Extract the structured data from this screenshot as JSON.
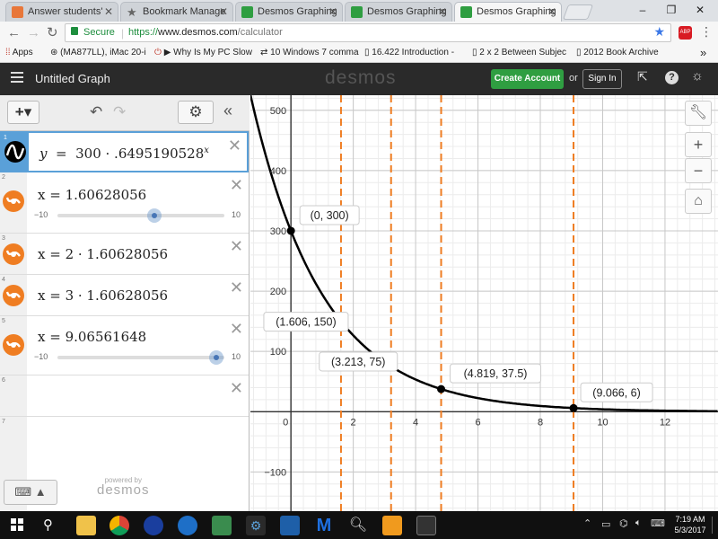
{
  "browser": {
    "tabs": [
      {
        "title": "Answer students'",
        "icon": "page-icon",
        "active": false
      },
      {
        "title": "Bookmark Manage",
        "icon": "star-icon",
        "active": false
      },
      {
        "title": "Desmos Graphing",
        "icon": "desmos-icon",
        "active": false
      },
      {
        "title": "Desmos Graphing",
        "icon": "desmos-icon",
        "active": false
      },
      {
        "title": "Desmos Graphing",
        "icon": "desmos-icon",
        "active": true
      }
    ],
    "window_controls": {
      "minimize": "–",
      "maximize": "❐",
      "close": "✕"
    },
    "secure_label": "Secure",
    "url_prefix": "https://",
    "url_host": "www.desmos.com",
    "url_path": "/calculator",
    "abp_label": "ABP",
    "bookmarks": [
      {
        "label": "Apps",
        "icon": "apps-grid-icon"
      },
      {
        "label": "(MA877LL), iMac 20-i",
        "icon": "wheel-icon"
      },
      {
        "label": "▶ Why Is My PC Slow",
        "icon": "power-icon"
      },
      {
        "label": "10 Windows 7 comma",
        "icon": "arrows-icon"
      },
      {
        "label": "16.422 Introduction -",
        "icon": "doc-icon"
      },
      {
        "label": "2 x 2 Between Subjec",
        "icon": "doc-icon"
      },
      {
        "label": "2012 Book Archive",
        "icon": "doc-icon"
      }
    ],
    "more_bookmarks": "»"
  },
  "desmos": {
    "graph_title": "Untitled Graph",
    "logo": "desmos",
    "create_account": "Create Account",
    "or_label": "or",
    "sign_in": "Sign In",
    "brand_green": "#2f9e41",
    "expressions": [
      {
        "n": "1",
        "type": "function",
        "lhs": "y",
        "mid": "300 · .6495190528",
        "exp": "x",
        "color": "#000000"
      },
      {
        "n": "2",
        "type": "slider",
        "text": "x = 1.60628056",
        "min": "−10",
        "max": "10",
        "value": 1.60628056,
        "color": "#ef7d22"
      },
      {
        "n": "3",
        "type": "vline",
        "text": "x = 2 · 1.60628056",
        "color": "#ef7d22"
      },
      {
        "n": "4",
        "type": "vline",
        "text": "x = 3 · 1.60628056",
        "color": "#ef7d22"
      },
      {
        "n": "5",
        "type": "slider",
        "text": "x = 9.06561648",
        "min": "−10",
        "max": "10",
        "value": 9.06561648,
        "color": "#ef7d22"
      },
      {
        "n": "6",
        "type": "empty"
      },
      {
        "n": "7",
        "type": "empty"
      }
    ],
    "powered_by": "powered by",
    "powered_logo": "desmos"
  },
  "chart_data": {
    "type": "line",
    "series": [
      {
        "expression": "y = 300 · 0.6495190528^x",
        "color": "#000000"
      }
    ],
    "vertical_lines": [
      1.60628056,
      3.21256112,
      4.81884168,
      9.06561648
    ],
    "vertical_line_color": "#ef7d22",
    "points": [
      {
        "x": 0,
        "y": 300,
        "label": "(0, 300)"
      },
      {
        "x": 1.606,
        "y": 150,
        "label": "(1.606, 150)"
      },
      {
        "x": 3.213,
        "y": 75,
        "label": "(3.213, 75)"
      },
      {
        "x": 4.819,
        "y": 37.5,
        "label": "(4.819, 37.5)"
      },
      {
        "x": 9.066,
        "y": 6,
        "label": "(9.066, 6)"
      }
    ],
    "x_ticks": [
      "0",
      "2",
      "4",
      "6",
      "8",
      "10",
      "12"
    ],
    "y_ticks": [
      "500",
      "400",
      "300",
      "200",
      "100",
      "−100"
    ],
    "xlim": [
      -1.3,
      13.7
    ],
    "ylim": [
      -165,
      525
    ],
    "grid": true
  },
  "taskbar": {
    "time": "7:19 AM",
    "date": "5/3/2017",
    "icons": [
      "windows-start-icon",
      "search-icon",
      "file-explorer-icon",
      "chrome-icon",
      "firefox-icon",
      "edge-icon",
      "photos-icon",
      "settings-icon",
      "app-icon",
      "malwarebytes-icon",
      "magnifier-icon",
      "app2-icon",
      "cmd-icon"
    ]
  }
}
